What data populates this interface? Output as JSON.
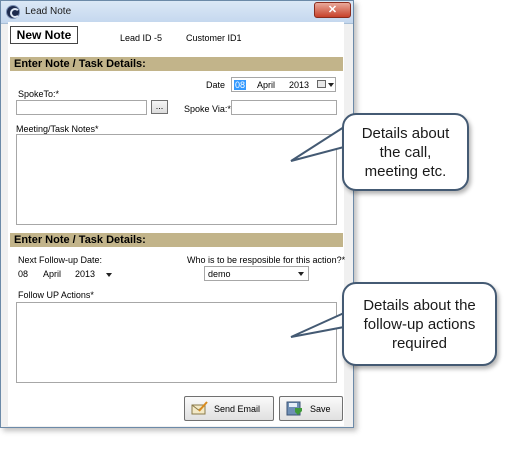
{
  "window": {
    "title": "Lead Note",
    "close_label": "✕"
  },
  "header": {
    "title": "New Note",
    "lead_id": "Lead ID  -5",
    "customer_id": "Customer ID1"
  },
  "section1": {
    "title": "Enter Note / Task Details:",
    "date_label": "Date",
    "date": {
      "day": "08",
      "month": "April",
      "year": "2013"
    },
    "spoke_to_label": "SpokeTo:*",
    "spoke_to_value": "",
    "browse_label": "...",
    "spoke_via_label": "Spoke Via:*",
    "spoke_via_value": "",
    "notes_label": "Meeting/Task Notes*",
    "notes_value": ""
  },
  "section2": {
    "title": "Enter Note / Task Details:",
    "followup_label": "Next Follow-up  Date:",
    "followup_date": {
      "day": "08",
      "month": "April",
      "year": "2013"
    },
    "responsible_label": "Who is to be resposible for this action?*",
    "responsible_value": "demo",
    "followup_actions_label": "Follow UP Actions*",
    "followup_actions_value": ""
  },
  "buttons": {
    "send_email": "Send Email",
    "save": "Save"
  },
  "callouts": {
    "top": [
      "Details about",
      "the call,",
      "meeting etc."
    ],
    "bottom": [
      "Details about the",
      "follow-up actions",
      "required"
    ]
  },
  "colors": {
    "section_bg": "#c2b48a",
    "callout_border": "#445a73",
    "selected": "#3399ff"
  }
}
